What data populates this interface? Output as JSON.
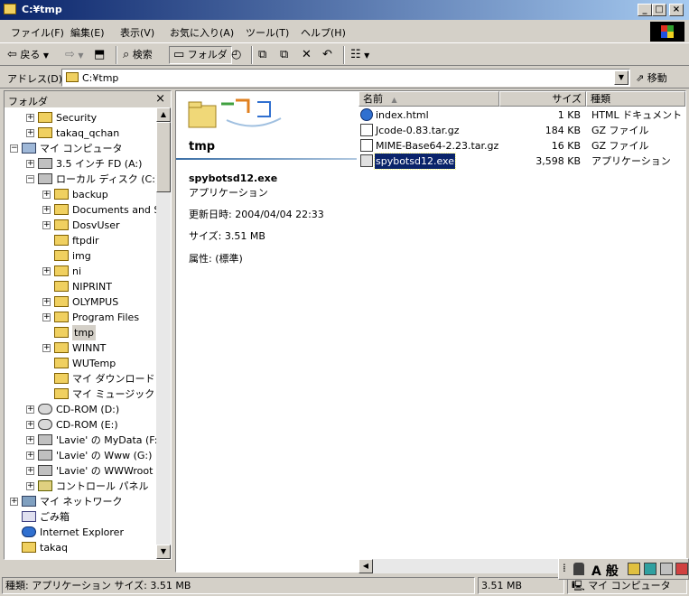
{
  "window": {
    "title": "C:¥tmp"
  },
  "title_buttons": {
    "minimize": "_",
    "maximize": "□",
    "close": "×"
  },
  "menu": [
    "ファイル(F)",
    "編集(E)",
    "表示(V)",
    "お気に入り(A)",
    "ツール(T)",
    "ヘルプ(H)"
  ],
  "toolbar": {
    "back_label": "戻る",
    "search_label": "検索",
    "folders_label": "フォルダ"
  },
  "address": {
    "label": "アドレス(D)",
    "value": "C:¥tmp",
    "go_label": "移動"
  },
  "folder_pane": {
    "title": "フォルダ",
    "close": "×",
    "items": [
      {
        "label": "Security",
        "icon": "folder",
        "expander": "+"
      },
      {
        "label": "takaq_qchan",
        "icon": "folder",
        "expander": "+"
      },
      {
        "label": "マイ コンピュータ",
        "icon": "computer",
        "expander": "−"
      },
      {
        "label": "3.5 インチ FD (A:)",
        "icon": "floppy-drive",
        "expander": "+"
      },
      {
        "label": "ローカル ディスク (C:)",
        "icon": "hard-drive",
        "expander": "−"
      },
      {
        "label": "backup",
        "icon": "folder",
        "expander": "+"
      },
      {
        "label": "Documents and S",
        "icon": "folder",
        "expander": "+"
      },
      {
        "label": "DosvUser",
        "icon": "folder",
        "expander": "+"
      },
      {
        "label": "ftpdir",
        "icon": "folder",
        "expander": ""
      },
      {
        "label": "img",
        "icon": "folder",
        "expander": ""
      },
      {
        "label": "ni",
        "icon": "folder",
        "expander": "+"
      },
      {
        "label": "NIPRINT",
        "icon": "folder",
        "expander": ""
      },
      {
        "label": "OLYMPUS",
        "icon": "folder",
        "expander": "+"
      },
      {
        "label": "Program Files",
        "icon": "folder",
        "expander": "+"
      },
      {
        "label": "tmp",
        "icon": "folder-open",
        "expander": ""
      },
      {
        "label": "WINNT",
        "icon": "folder",
        "expander": "+"
      },
      {
        "label": "WUTemp",
        "icon": "folder",
        "expander": ""
      },
      {
        "label": "マイ ダウンロード",
        "icon": "folder",
        "expander": ""
      },
      {
        "label": "マイ ミュージック",
        "icon": "folder",
        "expander": ""
      },
      {
        "label": "CD-ROM (D:)",
        "icon": "cd-drive",
        "expander": "+"
      },
      {
        "label": "CD-ROM (E:)",
        "icon": "cd-drive",
        "expander": "+"
      },
      {
        "label": "'Lavie' の MyData (F:",
        "icon": "network-drive",
        "expander": "+"
      },
      {
        "label": "'Lavie' の Www (G:)",
        "icon": "network-drive",
        "expander": "+"
      },
      {
        "label": "'Lavie' の WWWroot (H",
        "icon": "network-drive",
        "expander": "+"
      },
      {
        "label": "コントロール パネル",
        "icon": "control-panel",
        "expander": "+"
      },
      {
        "label": "マイ ネットワーク",
        "icon": "network",
        "expander": "+"
      },
      {
        "label": "ごみ箱",
        "icon": "recycle-bin",
        "expander": ""
      },
      {
        "label": "Internet Explorer",
        "icon": "ie",
        "expander": ""
      },
      {
        "label": "takaq",
        "icon": "folder",
        "expander": ""
      }
    ]
  },
  "webview": {
    "folder_name": "tmp",
    "selected_name": "spybotsd12.exe",
    "selected_type": "アプリケーション",
    "modified": "更新日時: 2004/04/04 22:33",
    "size": "サイズ: 3.51 MB",
    "attributes": "属性: (標準)"
  },
  "columns": {
    "name": "名前",
    "size": "サイズ",
    "type": "種類",
    "sort_indicator": "▲"
  },
  "files": [
    {
      "name": "index.html",
      "size": "1 KB",
      "type": "HTML ドキュメント",
      "icon": "html-file"
    },
    {
      "name": "Jcode-0.83.tar.gz",
      "size": "184 KB",
      "type": "GZ ファイル",
      "icon": "gz-file"
    },
    {
      "name": "MIME-Base64-2.23.tar.gz",
      "size": "16 KB",
      "type": "GZ ファイル",
      "icon": "gz-file"
    },
    {
      "name": "spybotsd12.exe",
      "size": "3,598 KB",
      "type": "アプリケーション",
      "icon": "exe-file",
      "selected": true
    }
  ],
  "status": {
    "info": "種類: アプリケーション サイズ: 3.51 MB",
    "size": "3.51 MB",
    "zone": "マイ コンピュータ"
  },
  "ime_tray": {
    "text": "A 般"
  }
}
